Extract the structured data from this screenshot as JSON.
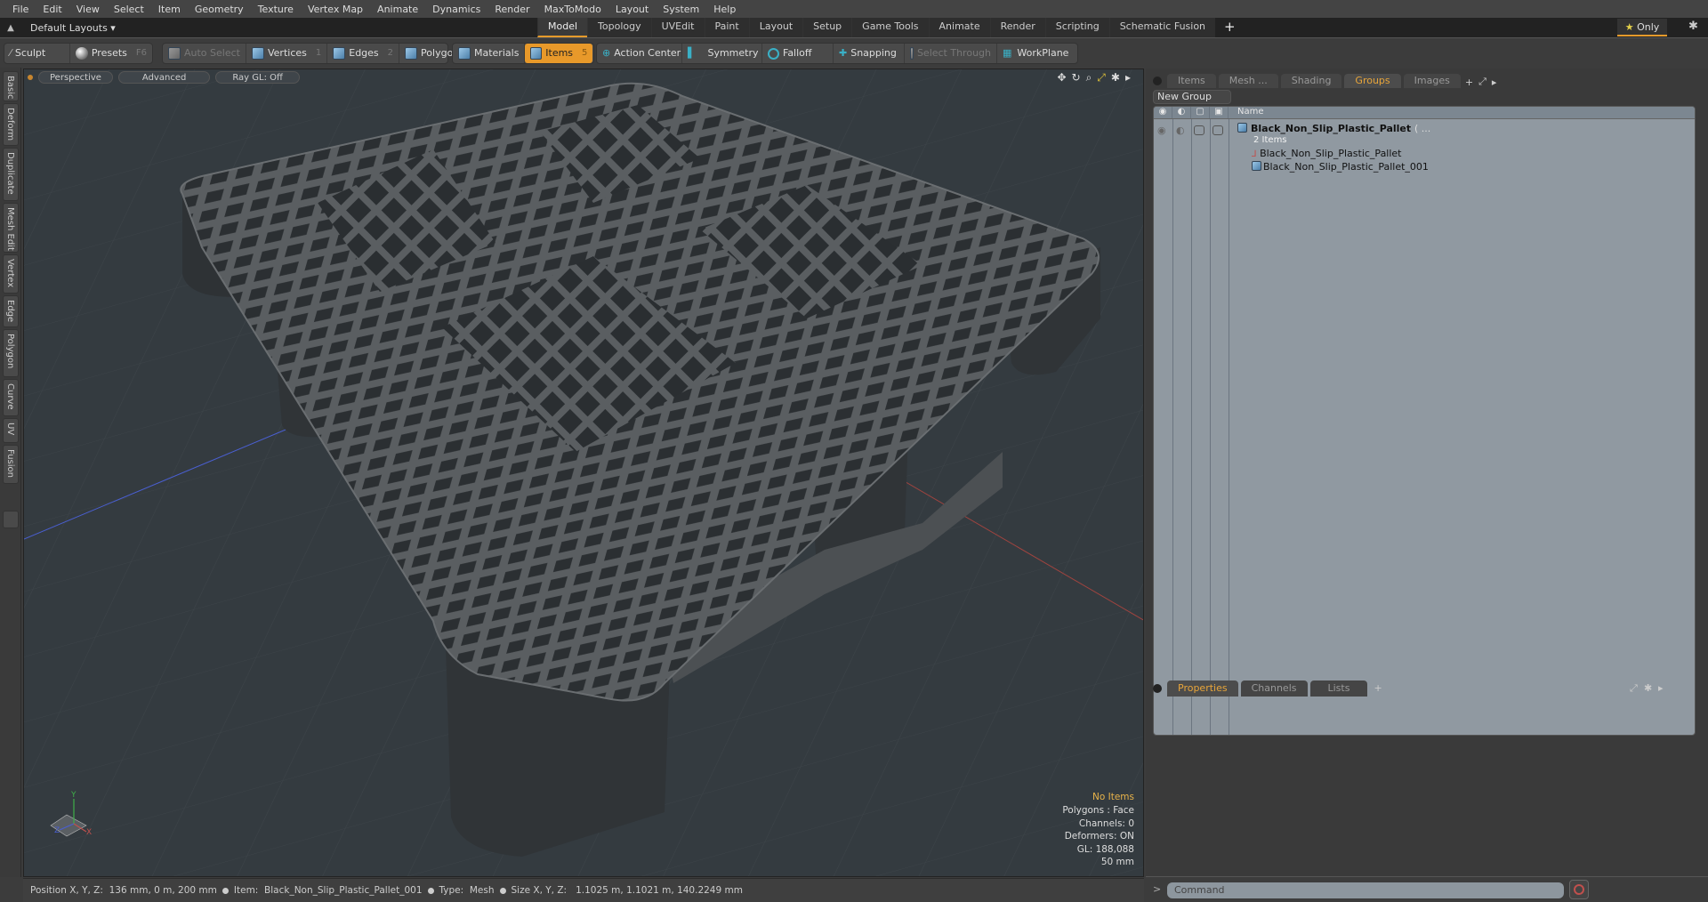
{
  "menu": [
    "File",
    "Edit",
    "View",
    "Select",
    "Item",
    "Geometry",
    "Texture",
    "Vertex Map",
    "Animate",
    "Dynamics",
    "Render",
    "MaxToModo",
    "Layout",
    "System",
    "Help"
  ],
  "layout_bar": {
    "layouts_label": "Default Layouts ▾",
    "tabs": [
      "Model",
      "Topology",
      "UVEdit",
      "Paint",
      "Layout",
      "Setup",
      "Game Tools",
      "Animate",
      "Render",
      "Scripting",
      "Schematic Fusion"
    ],
    "active_tab": "Model",
    "add_tab": "+",
    "only_label": "Only"
  },
  "toolbar": {
    "sculpt": "Sculpt",
    "presets": "Presets",
    "presets_key": "F6",
    "auto_select": "Auto Select",
    "vertices": "Vertices",
    "vertices_key": "1",
    "edges": "Edges",
    "edges_key": "2",
    "polygons": "Polygons",
    "materials": "Materials",
    "items": "Items",
    "items_key": "5",
    "action_center": "Action Center",
    "symmetry": "Symmetry",
    "falloff": "Falloff",
    "snapping": "Snapping",
    "select_through": "Select Through",
    "workplane": "WorkPlane"
  },
  "left_tabs": [
    "Basic",
    "Deform",
    "Duplicate",
    "Mesh Edit",
    "Vertex",
    "Edge",
    "Polygon",
    "Curve",
    "UV",
    "Fusion"
  ],
  "viewport": {
    "view_mode": "Perspective",
    "shading": "Advanced",
    "raygl": "Ray GL: Off",
    "info": {
      "selection": "No Items",
      "polygons": "Polygons : Face",
      "channels": "Channels: 0",
      "deformers": "Deformers: ON",
      "gl": "GL: 188,088",
      "grid": "50 mm"
    },
    "axis_labels": {
      "x": "X",
      "y": "Y",
      "z": "Z"
    },
    "colors": {
      "x_axis": "#c0504d",
      "y_axis": "#3fae49",
      "z_axis": "#4a5fd1",
      "background": "#343b40"
    }
  },
  "right_panel": {
    "tabs": [
      "Items",
      "Mesh ...",
      "Shading",
      "Groups",
      "Images"
    ],
    "active_tab": "Groups",
    "new_group": "New Group",
    "name_header": "Name",
    "tree": {
      "group_name": "Black_Non_Slip_Plastic_Pallet",
      "group_suffix": "( ...",
      "count": "2 Items",
      "children": [
        "Black_Non_Slip_Plastic_Pallet",
        "Black_Non_Slip_Plastic_Pallet_001"
      ]
    },
    "bottom_tabs": [
      "Properties",
      "Channels",
      "Lists"
    ],
    "bottom_active": "Properties",
    "command_placeholder": "Command",
    "command_prompt": ">"
  },
  "status_bar": {
    "position_label": "Position X, Y, Z:",
    "position_value": "136 mm, 0 m, 200 mm",
    "item_label": "Item:",
    "item_value": "Black_Non_Slip_Plastic_Pallet_001",
    "type_label": "Type:",
    "type_value": "Mesh",
    "size_label": "Size X, Y, Z:",
    "size_value": "1.1025 m, 1.1021 m, 140.2249 mm"
  },
  "accent_color": "#e8992a"
}
